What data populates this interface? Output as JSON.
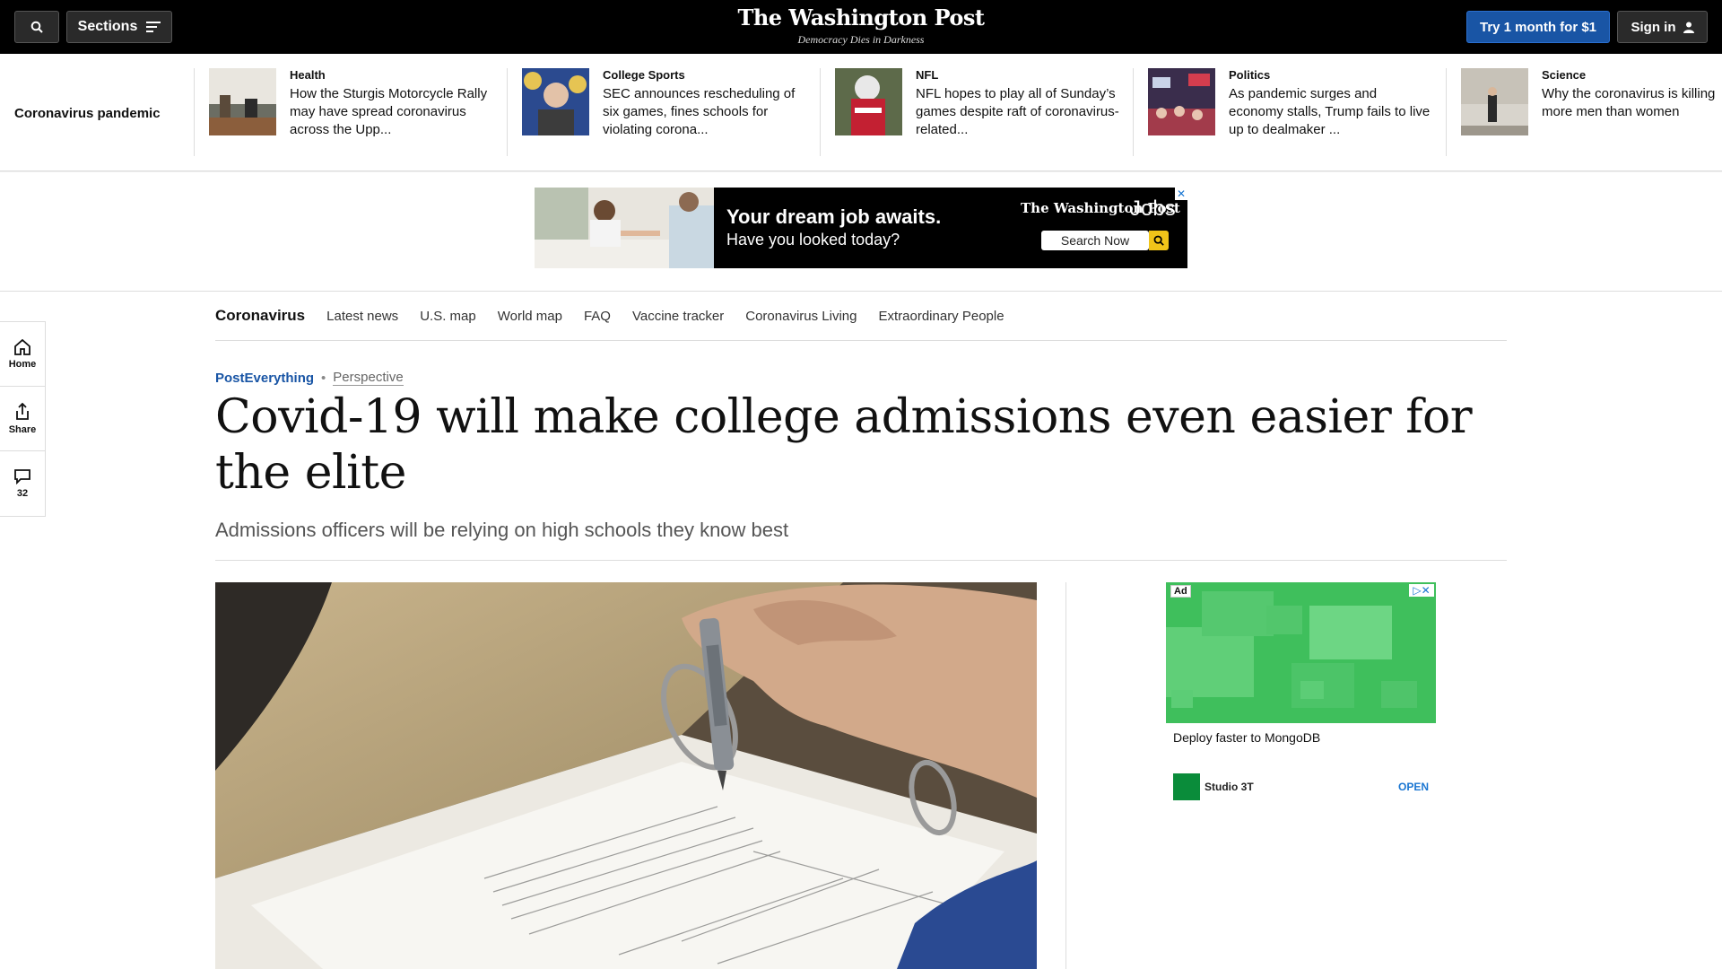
{
  "topbar": {
    "sections_label": "Sections",
    "logo": "The Washington Post",
    "tagline": "Democracy Dies in Darkness",
    "try_label": "Try 1 month for $1",
    "signin_label": "Sign in"
  },
  "strip": {
    "label": "Coronavirus pandemic",
    "items": [
      {
        "kicker": "Health",
        "title": "How the Sturgis Motorcycle Rally may have spread coronavirus across the Upp..."
      },
      {
        "kicker": "College Sports",
        "title": "SEC announces rescheduling of six games, fines schools for violating corona..."
      },
      {
        "kicker": "NFL",
        "title": "NFL hopes to play all of Sunday’s games despite raft of coronavirus-related..."
      },
      {
        "kicker": "Politics",
        "title": "As pandemic surges and economy stalls, Trump fails to live up to dealmaker ..."
      },
      {
        "kicker": "Science",
        "title": "Why the coronavirus is killing more men than women"
      }
    ]
  },
  "jobs_ad": {
    "line1": "Your dream job awaits.",
    "line2": "Have you looked today?",
    "logo": "The Washington Post",
    "jobs_word": "Jobs",
    "search_label": "Search Now"
  },
  "subnav": {
    "brand": "Coronavirus",
    "items": [
      "Latest news",
      "U.S. map",
      "World map",
      "FAQ",
      "Vaccine tracker",
      "Coronavirus Living",
      "Extraordinary People"
    ]
  },
  "rail": {
    "home": "Home",
    "share": "Share",
    "comments": "32"
  },
  "article": {
    "section": "PostEverything",
    "label": "Perspective",
    "headline": "Covid-19 will make college admissions even easier for the elite",
    "dek": "Admissions officers will be relying on high schools they know best"
  },
  "right_ad": {
    "badge": "Ad",
    "title": "Deploy faster to MongoDB",
    "brand": "Studio 3T",
    "cta": "OPEN"
  },
  "colors": {
    "accent_blue": "#1955a5",
    "topbar_bg": "#000000",
    "ad_green": "#3dbd5c"
  }
}
